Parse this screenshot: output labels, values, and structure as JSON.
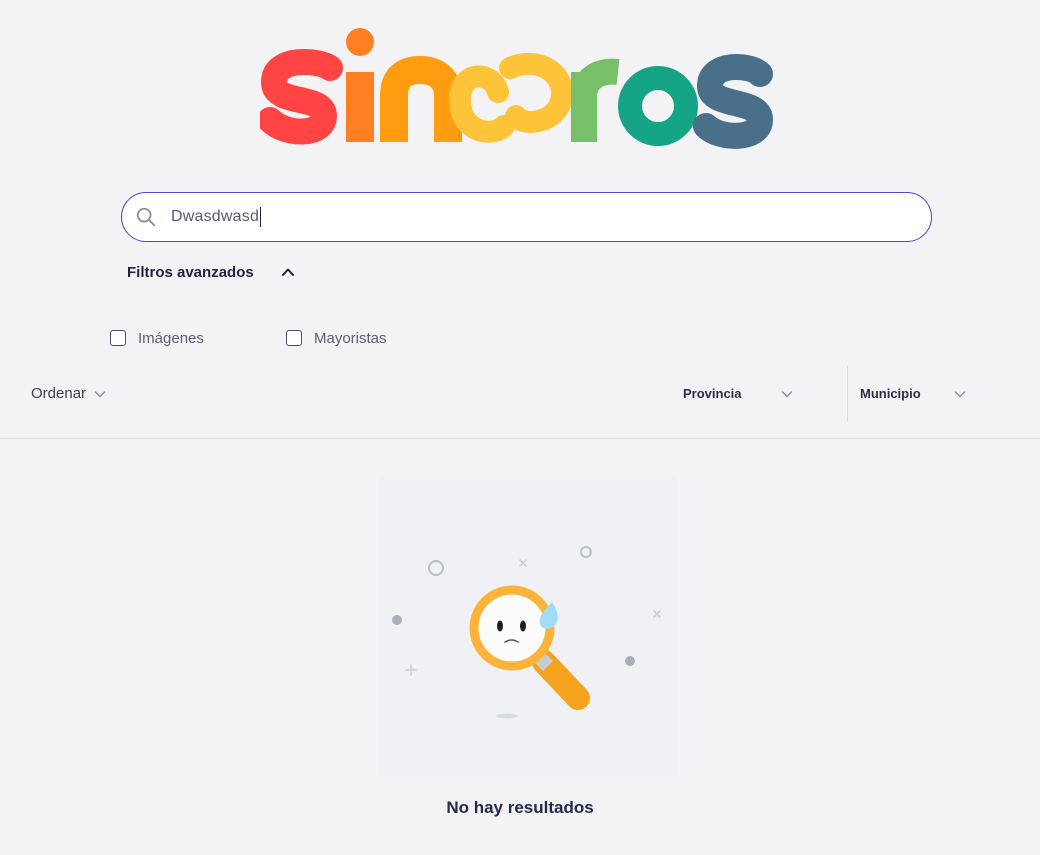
{
  "brand": {
    "logo_text": "sinceros",
    "colors": {
      "s1": "#ff4444",
      "i": "#ff7f22",
      "n": "#ff9c10",
      "c": "#fdc43a",
      "e": "#fdc43a",
      "r": "#76c06a",
      "o": "#16a487",
      "s2": "#4a6f8a"
    }
  },
  "search": {
    "value": "Dwasdwasd",
    "icon": "search-icon",
    "border_color": "#5b3fd0"
  },
  "advanced_filters": {
    "label": "Filtros avanzados",
    "expanded": true,
    "icon": "chevron-up-icon"
  },
  "filters": {
    "checkboxes": [
      {
        "label": "Imágenes",
        "checked": false
      },
      {
        "label": "Mayoristas",
        "checked": false
      }
    ]
  },
  "toolbar": {
    "sort_label": "Ordenar",
    "province_label": "Provincia",
    "municipality_label": "Municipio"
  },
  "results": {
    "empty_message": "No hay resultados",
    "illustration": "magnifier-sad-face-icon"
  }
}
